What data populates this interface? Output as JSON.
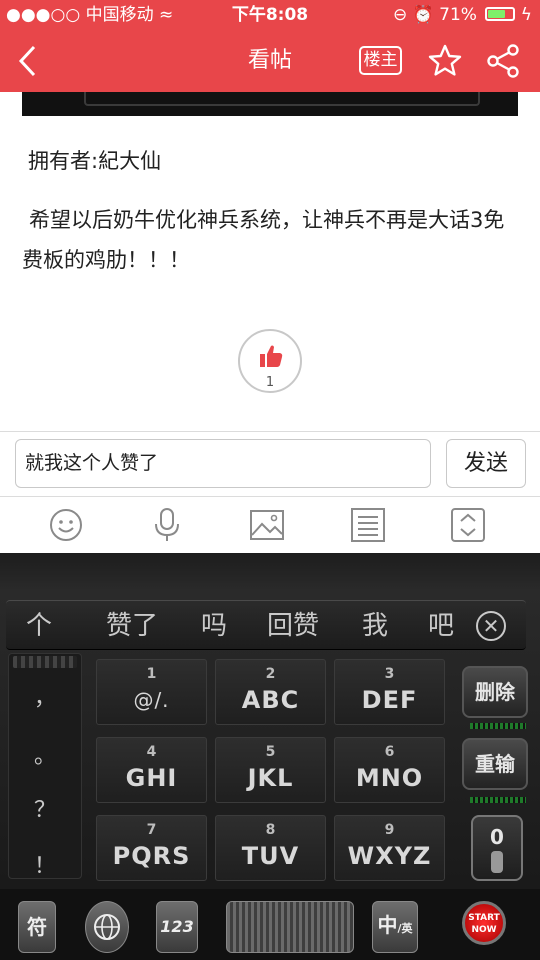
{
  "status_bar": {
    "signal": "●●●○○",
    "carrier": "中国移动",
    "wifi_glyph": "≈",
    "time": "下午8:08",
    "lock_glyph": "⊖",
    "alarm_glyph": "⏰",
    "battery_percent": "71%",
    "battery_level": 0.71,
    "charging_glyph": "ϟ"
  },
  "nav": {
    "title": "看帖",
    "owner_only_label": "楼主",
    "icons": [
      "back-icon",
      "star-icon",
      "share-icon"
    ]
  },
  "post": {
    "owner_line": "拥有者:紀大仙",
    "body": "希望以后奶牛优化神兵系统，让神兵不再是大话3免费板的鸡肋！！！",
    "like_count": "1",
    "like_icon": "thumbs-up-icon"
  },
  "comment": {
    "input_value": "就我这个人赞了",
    "send_label": "发送"
  },
  "toolbar": {
    "icons": [
      "emoji-icon",
      "microphone-icon",
      "image-icon",
      "list-icon",
      "expand-icon"
    ]
  },
  "keyboard": {
    "candidates": [
      "个",
      "赞了",
      "吗",
      "回赞",
      "我",
      "吧"
    ],
    "punctuation": [
      "，",
      "。",
      "？",
      "！"
    ],
    "keys": [
      {
        "num": "1",
        "letters": "@/."
      },
      {
        "num": "2",
        "letters": "ABC"
      },
      {
        "num": "3",
        "letters": "DEF"
      },
      {
        "num": "4",
        "letters": "GHI"
      },
      {
        "num": "5",
        "letters": "JKL"
      },
      {
        "num": "6",
        "letters": "MNO"
      },
      {
        "num": "7",
        "letters": "PQRS"
      },
      {
        "num": "8",
        "letters": "TUV"
      },
      {
        "num": "9",
        "letters": "WXYZ"
      }
    ],
    "delete_label": "删除",
    "enter_label": "重输",
    "zero_label": "0",
    "symbol_label": "符",
    "number_mode_label": "123",
    "lang_label_cn": "中",
    "lang_label_en": "/英",
    "start_label": "START NOW",
    "colors": {
      "accent": "#e8464a",
      "key_text": "#d8d8d8"
    }
  }
}
